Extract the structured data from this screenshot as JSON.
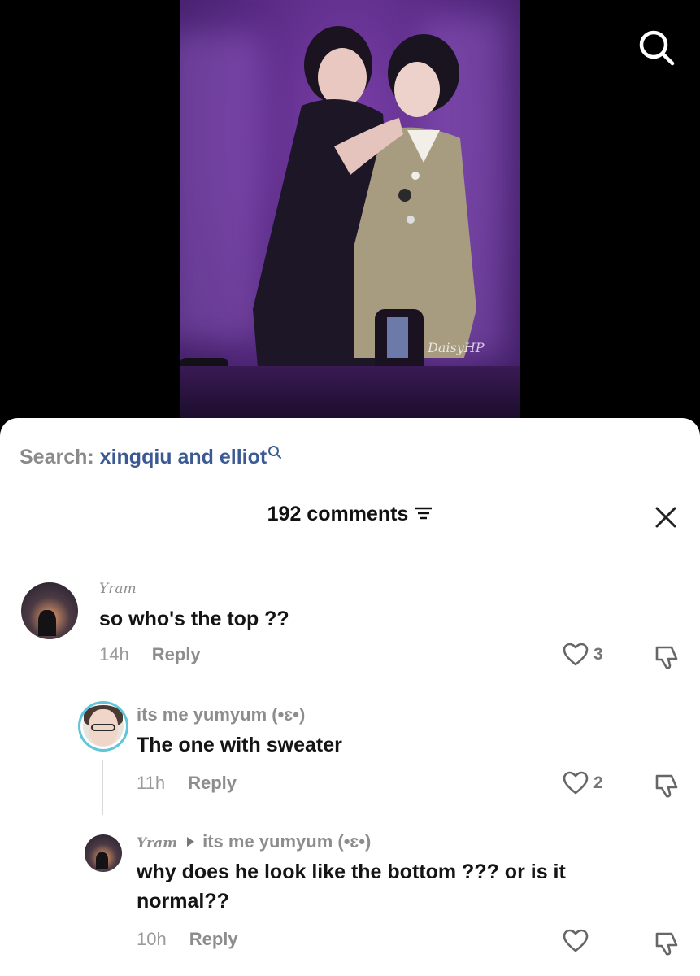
{
  "search": {
    "prefix": "Search:",
    "query": "xingqiu and elliot"
  },
  "comments_header": {
    "count_label": "192 comments"
  },
  "comments": [
    {
      "username": "Yram",
      "text": "so who's the top ??",
      "time": "14h",
      "reply_label": "Reply",
      "likes": "3"
    },
    {
      "username": "its me yumyum (•ɛ•)",
      "text": "The one with sweater",
      "time": "11h",
      "reply_label": "Reply",
      "likes": "2"
    },
    {
      "username": "Yram",
      "reply_to": "its me yumyum (•ɛ•)",
      "text_line1": "why does he look like the bottom ??? or is it",
      "text_line2": "normal??",
      "time": "10h",
      "reply_label": "Reply",
      "likes": ""
    }
  ],
  "watermark": "DaisyHP",
  "colors": {
    "accent_query": "#3b5a94",
    "avatar_ring": "#5fc5d8",
    "stage_purple": "#5a2b86"
  },
  "icons": [
    "search-icon",
    "filter-icon",
    "close-icon",
    "heart-icon",
    "dislike-icon"
  ]
}
